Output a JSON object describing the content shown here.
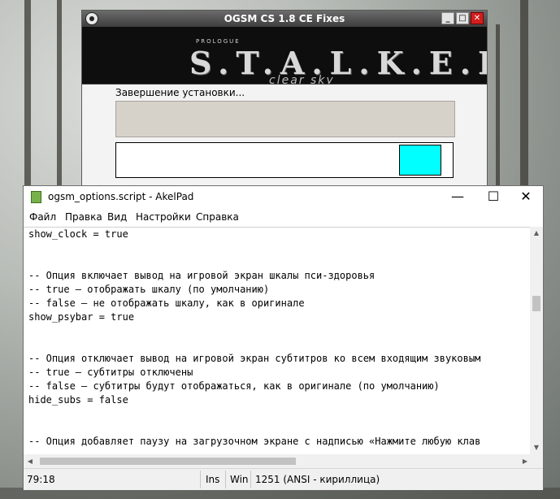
{
  "installer": {
    "title": "OGSM CS 1.8 CE Fixes",
    "minimize": "_",
    "maximize": "□",
    "close": "✕",
    "banner": {
      "prologue": "PROLOGUE",
      "logo": "S.T.A.L.K.E.R.",
      "subtitle": "clear sky"
    },
    "status_text": "Завершение установки...",
    "progress_fraction": 0.12
  },
  "akelpad": {
    "title": "ogsm_options.script - AkelPad",
    "controls": {
      "minimize": "—",
      "maximize": "☐",
      "close": "✕"
    },
    "menu": [
      "Файл",
      "Правка",
      "Вид",
      "Настройки",
      "Справка"
    ],
    "editor_lines": [
      "show_clock = true",
      "",
      "",
      "-- Опция включает вывод на игровой экран шкалы пси-здоровья",
      "-- true — отображать шкалу (по умолчанию)",
      "-- false — не отображать шкалу, как в оригинале",
      "show_psybar = true",
      "",
      "",
      "-- Опция отключает вывод на игровой экран субтитров ко всем входящим звуковым",
      "-- true — субтитры отключены",
      "-- false — субтитры будут отображаться, как в оригинале (по умолчанию)",
      "hide_subs = false",
      "",
      "",
      "-- Опция добавляет паузу на загрузочном экране с надписью «Нажмите любую клав"
    ],
    "status": {
      "position": "79:18",
      "insert_mode": "Ins",
      "line_ending": "Win",
      "encoding": "1251  (ANSI - кириллица)"
    }
  }
}
